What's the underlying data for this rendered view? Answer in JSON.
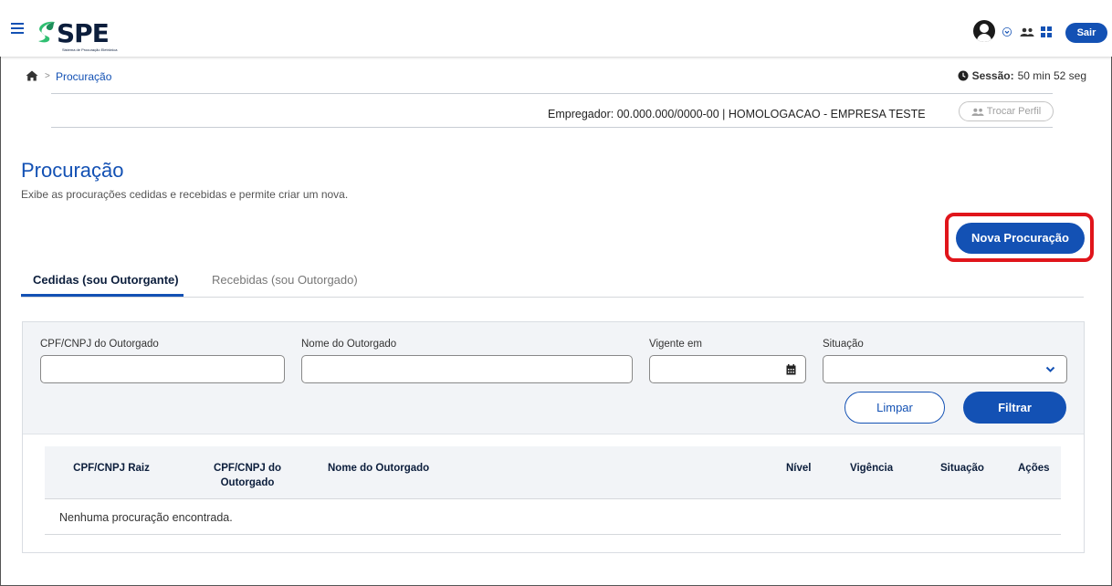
{
  "header": {
    "logo_text": "SPE",
    "logo_subtitle": "Sistema de Procuração Eletrônica",
    "logout_label": "Sair"
  },
  "breadcrumb": {
    "current": "Procuração"
  },
  "session": {
    "label": "Sessão:",
    "value": "50 min 52 seg"
  },
  "profile": {
    "employer_text": "Empregador: 00.000.000/0000-00 | HOMOLOGACAO - EMPRESA TESTE",
    "switch_label": "Trocar Perfil"
  },
  "page": {
    "title": "Procuração",
    "description": "Exibe as procurações cedidas e recebidas e permite criar um nova.",
    "new_button": "Nova Procuração"
  },
  "tabs": [
    {
      "label": "Cedidas (sou Outorgante)",
      "active": true
    },
    {
      "label": "Recebidas (sou Outorgado)",
      "active": false
    }
  ],
  "filters": {
    "cpf_label": "CPF/CNPJ do Outorgado",
    "cpf_value": "",
    "name_label": "Nome do Outorgado",
    "name_value": "",
    "date_label": "Vigente em",
    "date_value": "",
    "status_label": "Situação",
    "status_value": "",
    "clear_label": "Limpar",
    "filter_label": "Filtrar"
  },
  "table": {
    "columns": [
      "CPF/CNPJ Raiz",
      "CPF/CNPJ do Outorgado",
      "Nome do Outorgado",
      "Nível",
      "Vigência",
      "Situação",
      "Ações"
    ],
    "empty_message": "Nenhuma procuração encontrada."
  },
  "colors": {
    "primary": "#1351b4",
    "highlight": "#e0151b",
    "panel_bg": "#f2f4f7",
    "dark_text": "#0c1e3c"
  }
}
